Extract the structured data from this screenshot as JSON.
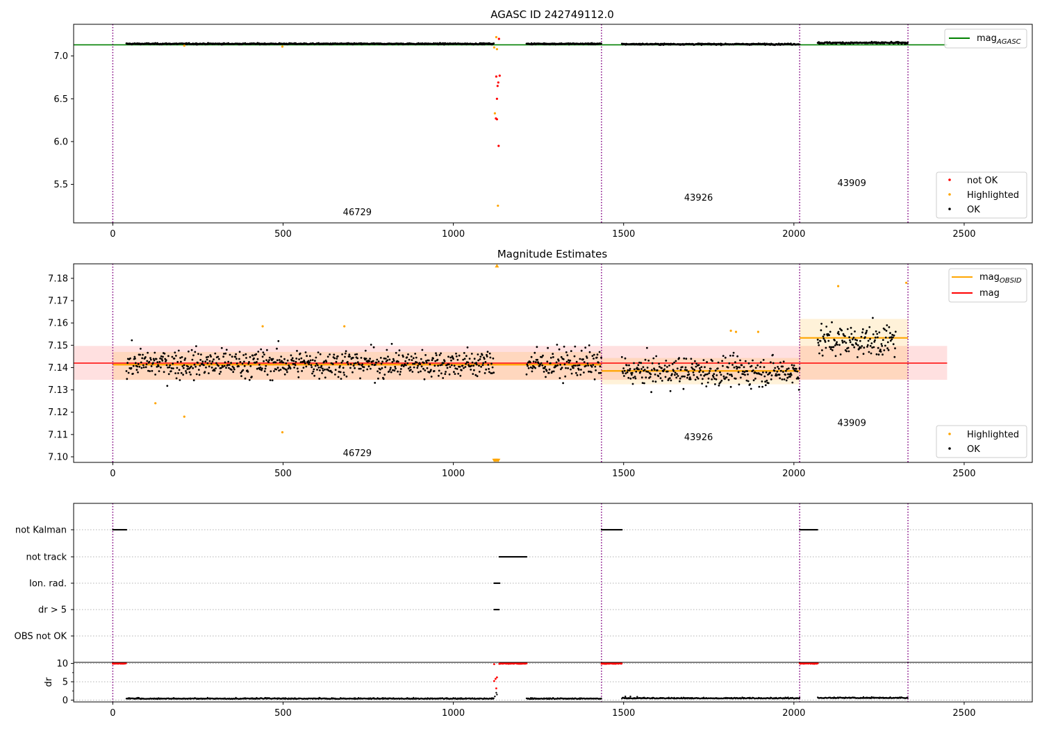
{
  "chart_data": [
    {
      "type": "scatter",
      "title": "AGASC ID 242749112.0",
      "xlim": [
        -115,
        2700
      ],
      "ylim": [
        5.05,
        7.37
      ],
      "xticks": [
        0,
        500,
        1000,
        1500,
        2000,
        2500
      ],
      "yticks": [
        5.5,
        6.0,
        6.5,
        7.0
      ],
      "xtick_labels": [
        "0",
        "500",
        "1000",
        "1500",
        "2000",
        "2500"
      ],
      "ytick_labels": [
        "5.5",
        "6.0",
        "6.5",
        "7.0"
      ],
      "obsid_boundaries": [
        0,
        1435,
        2017,
        2335
      ],
      "obsid_labels": [
        {
          "text": "46729",
          "x": 718,
          "y": 5.14
        },
        {
          "text": "43926",
          "x": 1720,
          "y": 5.31
        },
        {
          "text": "43909",
          "x": 2170,
          "y": 5.48
        }
      ],
      "hlines": [
        {
          "name": "mag_AGASC",
          "y": 7.13,
          "x0": -115,
          "x1": 2450,
          "color": "#008000"
        }
      ],
      "segments": [
        {
          "x0": 40,
          "x1": 1120,
          "mean": 7.142,
          "sd": 0.006
        },
        {
          "x0": 1215,
          "x1": 1435,
          "mean": 7.142,
          "sd": 0.006
        },
        {
          "x0": 1495,
          "x1": 2017,
          "mean": 7.138,
          "sd": 0.006
        },
        {
          "x0": 2070,
          "x1": 2335,
          "mean": 7.153,
          "sd": 0.008
        }
      ],
      "not_ok_points": [
        {
          "x": 1125,
          "y": 6.27
        },
        {
          "x": 1128,
          "y": 6.26
        },
        {
          "x": 1130,
          "y": 6.65
        },
        {
          "x": 1126,
          "y": 6.76
        },
        {
          "x": 1132,
          "y": 6.69
        },
        {
          "x": 1136,
          "y": 6.77
        },
        {
          "x": 1128,
          "y": 6.5
        },
        {
          "x": 1134,
          "y": 7.2
        },
        {
          "x": 1133,
          "y": 5.95
        }
      ],
      "highlighted_points": [
        {
          "x": 1120,
          "y": 7.1
        },
        {
          "x": 1126,
          "y": 7.22
        },
        {
          "x": 1128,
          "y": 7.08
        },
        {
          "x": 1122,
          "y": 6.33
        },
        {
          "x": 1131,
          "y": 5.25
        },
        {
          "x": 498,
          "y": 7.11
        },
        {
          "x": 210,
          "y": 7.12
        }
      ],
      "legend_top": [
        {
          "label": "mag",
          "sub": "AGASC",
          "color": "#008000"
        }
      ],
      "legend_bottom": [
        {
          "label": "not OK",
          "color": "#ff0000"
        },
        {
          "label": "Highlighted",
          "color": "#ffa500"
        },
        {
          "label": "OK",
          "color": "#000000"
        }
      ],
      "legend_top_loc": "upper right",
      "legend_bottom_loc": "lower right"
    },
    {
      "type": "scatter",
      "title": "Magnitude Estimates",
      "xlim": [
        -115,
        2700
      ],
      "ylim": [
        7.0975,
        7.1865
      ],
      "xticks": [
        0,
        500,
        1000,
        1500,
        2000,
        2500
      ],
      "yticks": [
        7.1,
        7.11,
        7.12,
        7.13,
        7.14,
        7.15,
        7.16,
        7.17,
        7.18
      ],
      "xtick_labels": [
        "0",
        "500",
        "1000",
        "1500",
        "2000",
        "2500"
      ],
      "ytick_labels": [
        "7.10",
        "7.11",
        "7.12",
        "7.13",
        "7.14",
        "7.15",
        "7.16",
        "7.17",
        "7.18"
      ],
      "obsid_boundaries": [
        0,
        1435,
        2017,
        2335
      ],
      "obsid_labels": [
        {
          "text": "46729",
          "x": 718,
          "y": 7.1003
        },
        {
          "text": "43926",
          "x": 1720,
          "y": 7.1075
        },
        {
          "text": "43909",
          "x": 2170,
          "y": 7.1138
        }
      ],
      "mag": {
        "value": 7.142,
        "band": [
          7.1345,
          7.1497
        ],
        "x0": -115,
        "x1": 2450,
        "color": "#ff0000"
      },
      "obsid_mag": [
        {
          "x0": 0,
          "x1": 1435,
          "value": 7.1413,
          "band": [
            7.1345,
            7.147
          ],
          "color": "#ffa500"
        },
        {
          "x0": 1435,
          "x1": 2017,
          "value": 7.1385,
          "band": [
            7.1325,
            7.1443
          ],
          "color": "#ffa500"
        },
        {
          "x0": 2017,
          "x1": 2335,
          "value": 7.1533,
          "band": [
            7.1347,
            7.1618
          ],
          "color": "#ffa500"
        }
      ],
      "segments": [
        {
          "x0": 40,
          "x1": 1120,
          "mean": 7.1418,
          "sd": 0.0055
        },
        {
          "x0": 1215,
          "x1": 1435,
          "mean": 7.1418,
          "sd": 0.0055
        },
        {
          "x0": 1495,
          "x1": 2017,
          "mean": 7.1382,
          "sd": 0.0055
        },
        {
          "x0": 2070,
          "x1": 2300,
          "mean": 7.152,
          "sd": 0.006
        }
      ],
      "highlighted_points": [
        {
          "x": 125,
          "y": 7.124
        },
        {
          "x": 210,
          "y": 7.118
        },
        {
          "x": 440,
          "y": 7.1585
        },
        {
          "x": 498,
          "y": 7.111
        },
        {
          "x": 680,
          "y": 7.1585
        },
        {
          "x": 1815,
          "y": 7.1565
        },
        {
          "x": 1830,
          "y": 7.156
        },
        {
          "x": 1895,
          "y": 7.156
        },
        {
          "x": 2130,
          "y": 7.1765
        },
        {
          "x": 2330,
          "y": 7.178
        }
      ],
      "offscale_markers": [
        {
          "x": 1128,
          "y": 7.1855,
          "dir": "up"
        },
        {
          "x": 1120,
          "y": 7.0985,
          "dir": "down"
        },
        {
          "x": 1124,
          "y": 7.0985,
          "dir": "down"
        },
        {
          "x": 1128,
          "y": 7.0985,
          "dir": "down"
        },
        {
          "x": 1132,
          "y": 7.0985,
          "dir": "down"
        }
      ],
      "legend_top": [
        {
          "label": "mag",
          "sub": "OBSID",
          "color": "#ffa500"
        },
        {
          "label": "mag",
          "sub": "",
          "color": "#ff0000"
        }
      ],
      "legend_bottom": [
        {
          "label": "Highlighted",
          "color": "#ffa500"
        },
        {
          "label": "OK",
          "color": "#000000"
        }
      ],
      "legend_top_loc": "upper right",
      "legend_bottom_loc": "lower right"
    },
    {
      "type": "scatter",
      "title": "",
      "xlim": [
        -115,
        2700
      ],
      "categories": [
        "not Kalman",
        "not track",
        "Ion. rad.",
        "dr > 5",
        "OBS not OK"
      ],
      "flag_segments": [
        {
          "flag": "not Kalman",
          "x0": 0,
          "x1": 40
        },
        {
          "flag": "not Kalman",
          "x0": 1435,
          "x1": 1495
        },
        {
          "flag": "not Kalman",
          "x0": 2017,
          "x1": 2070
        },
        {
          "flag": "not track",
          "x0": 1135,
          "x1": 1215
        },
        {
          "flag": "Ion. rad.",
          "x0": 1120,
          "x1": 1136
        },
        {
          "flag": "dr > 5",
          "x0": 1120,
          "x1": 1134
        }
      ],
      "obsid_boundaries": [
        0,
        1435,
        2017,
        2335
      ]
    },
    {
      "type": "scatter",
      "title": "",
      "ylabel": "dr",
      "xlim": [
        -115,
        2700
      ],
      "ylim": [
        -0.5,
        10.3
      ],
      "xticks": [
        0,
        500,
        1000,
        1500,
        2000,
        2500
      ],
      "yticks": [
        0,
        5,
        10
      ],
      "xtick_labels": [
        "0",
        "500",
        "1000",
        "1500",
        "2000",
        "2500"
      ],
      "ytick_labels": [
        "0",
        "5",
        "10"
      ],
      "capped_segments": [
        {
          "x0": 0,
          "x1": 40,
          "y": 10
        },
        {
          "x0": 1135,
          "x1": 1215,
          "y": 10
        },
        {
          "x0": 1435,
          "x1": 1495,
          "y": 10
        },
        {
          "x0": 2017,
          "x1": 2070,
          "y": 10
        }
      ],
      "not_ok_points": [
        {
          "x": 1120,
          "y": 5.2
        },
        {
          "x": 1124,
          "y": 5.8
        },
        {
          "x": 1128,
          "y": 6.2
        },
        {
          "x": 1126,
          "y": 3.2
        },
        {
          "x": 1120,
          "y": 9.8
        }
      ],
      "ok_segments": [
        {
          "x0": 40,
          "x1": 1120,
          "mean": 0.3
        },
        {
          "x0": 1215,
          "x1": 1435,
          "mean": 0.3
        },
        {
          "x0": 1495,
          "x1": 2017,
          "mean": 0.4
        },
        {
          "x0": 2070,
          "x1": 2335,
          "mean": 0.5
        }
      ],
      "ok_points_extra": [
        {
          "x": 1122,
          "y": 1.0
        },
        {
          "x": 1126,
          "y": 2.0
        },
        {
          "x": 1128,
          "y": 1.5
        },
        {
          "x": 1505,
          "y": 1.0
        },
        {
          "x": 1520,
          "y": 1.0
        },
        {
          "x": 1540,
          "y": 0.9
        }
      ],
      "obsid_boundaries": [
        0,
        1435,
        2017,
        2335
      ]
    }
  ]
}
